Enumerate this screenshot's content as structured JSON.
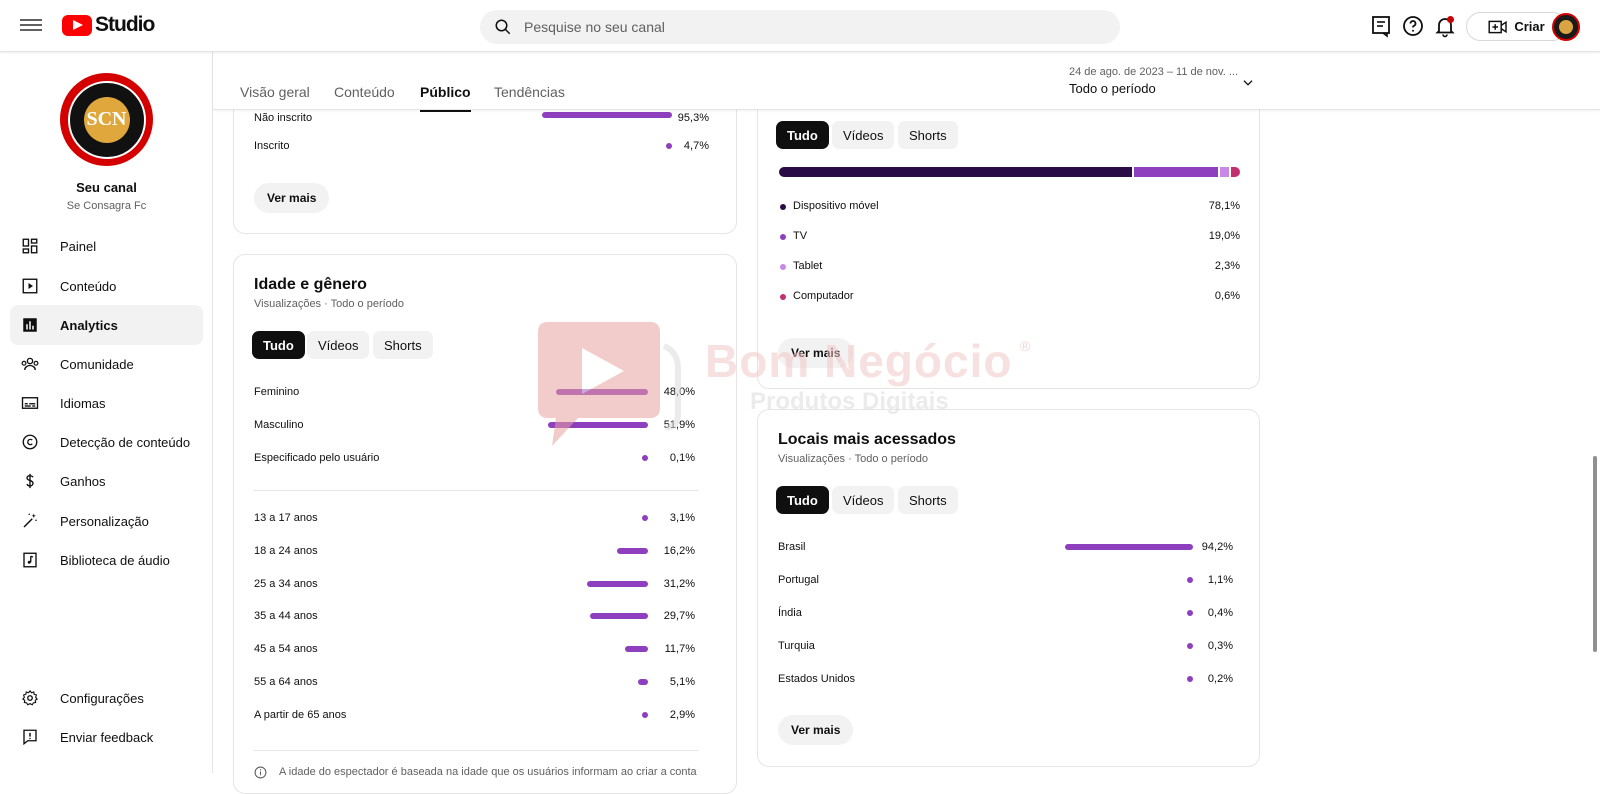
{
  "header": {
    "logo_text": "Studio",
    "search_placeholder": "Pesquise no seu canal",
    "create_label": "Criar"
  },
  "sidebar": {
    "channel_name": "Seu canal",
    "channel_handle": "Se Consagra Fc",
    "avatar_text": "SCN",
    "items": [
      {
        "label": "Painel",
        "icon": "dashboard-icon"
      },
      {
        "label": "Conteúdo",
        "icon": "content-icon"
      },
      {
        "label": "Analytics",
        "icon": "analytics-icon",
        "active": true
      },
      {
        "label": "Comunidade",
        "icon": "community-icon"
      },
      {
        "label": "Idiomas",
        "icon": "subtitles-icon"
      },
      {
        "label": "Detecção de conteúdo",
        "icon": "copyright-icon"
      },
      {
        "label": "Ganhos",
        "icon": "dollar-icon"
      },
      {
        "label": "Personalização",
        "icon": "magic-wand-icon"
      },
      {
        "label": "Biblioteca de áudio",
        "icon": "audio-library-icon"
      }
    ],
    "bottom_items": [
      {
        "label": "Configurações",
        "icon": "gear-icon"
      },
      {
        "label": "Enviar feedback",
        "icon": "feedback-icon"
      }
    ]
  },
  "tabs": {
    "overview": "Visão geral",
    "content": "Conteúdo",
    "audience": "Público",
    "trends": "Tendências",
    "date_range": "24 de ago. de 2023 – 11 de nov. ...",
    "period": "Todo o período"
  },
  "subscription_card": {
    "rows": [
      {
        "label": "Não inscrito",
        "value": "95,3%",
        "pct": 95.3
      },
      {
        "label": "Inscrito",
        "value": "4,7%",
        "pct": 4.7
      }
    ],
    "more": "Ver mais"
  },
  "age_gender_card": {
    "title": "Idade e gênero",
    "subtitle": "Visualizações · Todo o período",
    "chips": [
      "Tudo",
      "Vídeos",
      "Shorts"
    ],
    "gender": [
      {
        "label": "Feminino",
        "value": "48,0%",
        "pct": 48.0
      },
      {
        "label": "Masculino",
        "value": "51,9%",
        "pct": 51.9
      },
      {
        "label": "Especificado pelo usuário",
        "value": "0,1%",
        "pct": 0.1
      }
    ],
    "age": [
      {
        "label": "13 a 17 anos",
        "value": "3,1%",
        "pct": 3.1
      },
      {
        "label": "18 a 24 anos",
        "value": "16,2%",
        "pct": 16.2
      },
      {
        "label": "25 a 34 anos",
        "value": "31,2%",
        "pct": 31.2
      },
      {
        "label": "35 a 44 anos",
        "value": "29,7%",
        "pct": 29.7
      },
      {
        "label": "45 a 54 anos",
        "value": "11,7%",
        "pct": 11.7
      },
      {
        "label": "55 a 64 anos",
        "value": "5,1%",
        "pct": 5.1
      },
      {
        "label": "A partir de 65 anos",
        "value": "2,9%",
        "pct": 2.9
      }
    ],
    "footnote": "A idade do espectador é baseada na idade que os usuários informam ao criar a conta"
  },
  "device_card": {
    "chips": [
      "Tudo",
      "Vídeos",
      "Shorts"
    ],
    "rows": [
      {
        "label": "Dispositivo móvel",
        "value": "78,1%",
        "pct": 78.1,
        "color": "#2b0b45"
      },
      {
        "label": "TV",
        "value": "19,0%",
        "pct": 19.0,
        "color": "#8e3fbd"
      },
      {
        "label": "Tablet",
        "value": "2,3%",
        "pct": 2.3,
        "color": "#c889e6"
      },
      {
        "label": "Computador",
        "value": "0,6%",
        "pct": 0.6,
        "color": "#c2306e"
      }
    ],
    "more": "Ver mais"
  },
  "locations_card": {
    "title": "Locais mais acessados",
    "subtitle": "Visualizações · Todo o período",
    "chips": [
      "Tudo",
      "Vídeos",
      "Shorts"
    ],
    "rows": [
      {
        "label": "Brasil",
        "value": "94,2%",
        "pct": 94.2
      },
      {
        "label": "Portugal",
        "value": "1,1%",
        "pct": 1.1
      },
      {
        "label": "Índia",
        "value": "0,4%",
        "pct": 0.4
      },
      {
        "label": "Turquia",
        "value": "0,3%",
        "pct": 0.3
      },
      {
        "label": "Estados Unidos",
        "value": "0,2%",
        "pct": 0.2
      }
    ],
    "more": "Ver mais"
  },
  "watermark": {
    "line1": "Bom Negócio",
    "line2": "Produtos Digitais",
    "registered": "®"
  },
  "colors": {
    "accent": "#8e3fbd",
    "brand_red": "#ff0000"
  }
}
